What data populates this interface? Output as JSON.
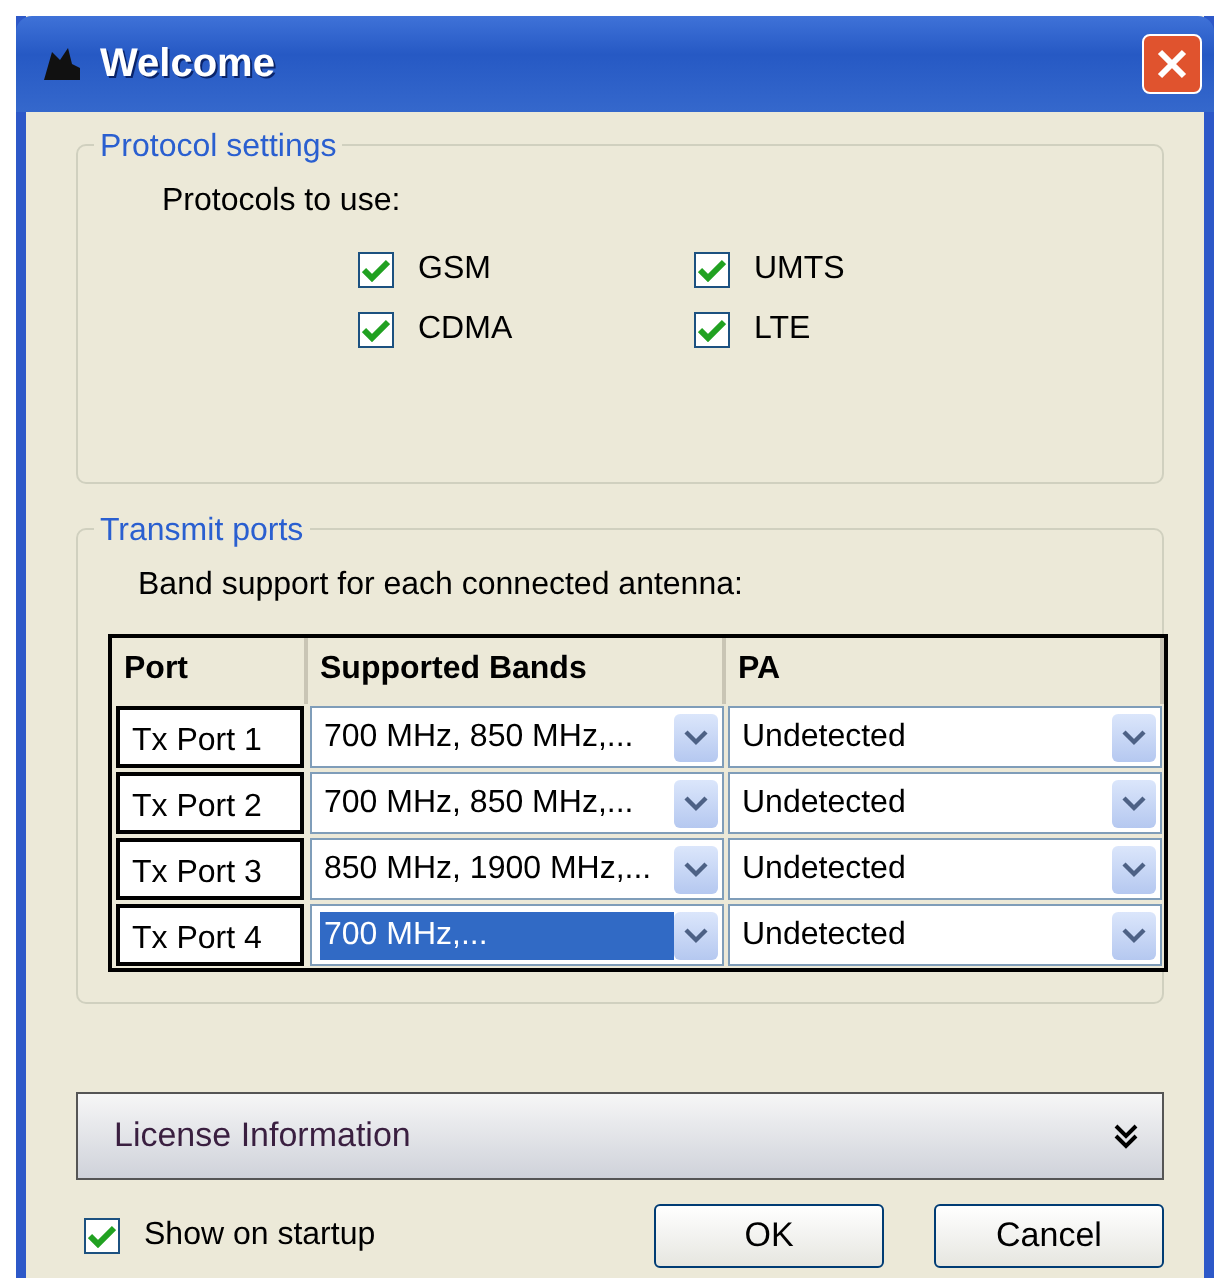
{
  "window": {
    "title": "Welcome"
  },
  "protocol_settings": {
    "title": "Protocol settings",
    "label": "Protocols to use:",
    "protocols": [
      {
        "label": "GSM",
        "checked": true
      },
      {
        "label": "UMTS",
        "checked": true
      },
      {
        "label": "CDMA",
        "checked": true
      },
      {
        "label": "LTE",
        "checked": true
      }
    ]
  },
  "transmit_ports": {
    "title": "Transmit ports",
    "label": "Band support for each connected antenna:",
    "table": {
      "columns": [
        "Port",
        "Supported Bands",
        "PA"
      ],
      "rows": [
        {
          "port": "Tx Port 1",
          "bands": "700 MHz, 850 MHz,...",
          "bands_selected": false,
          "pa": "Undetected"
        },
        {
          "port": "Tx Port 2",
          "bands": "700 MHz, 850 MHz,...",
          "bands_selected": false,
          "pa": "Undetected"
        },
        {
          "port": "Tx Port 3",
          "bands": "850 MHz, 1900 MHz,...",
          "bands_selected": false,
          "pa": "Undetected"
        },
        {
          "port": "Tx Port 4",
          "bands": "700 MHz,...",
          "bands_selected": true,
          "pa": "Undetected"
        }
      ]
    }
  },
  "license": {
    "label": "License Information",
    "expanded": false
  },
  "show_on_startup": {
    "label": "Show on startup",
    "checked": true
  },
  "buttons": [
    "OK",
    "Cancel"
  ]
}
